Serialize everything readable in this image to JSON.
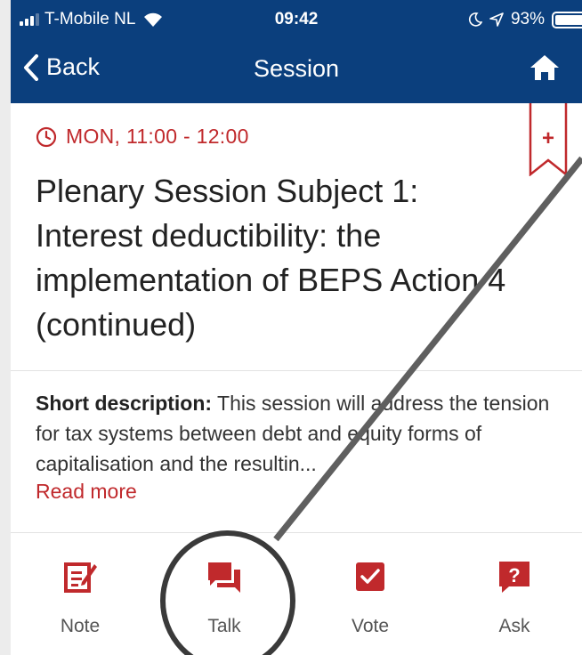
{
  "status_bar": {
    "carrier": "T-Mobile NL",
    "time": "09:42",
    "battery": "93%",
    "battery_level": 0.93
  },
  "nav": {
    "back_label": "Back",
    "title": "Session"
  },
  "session": {
    "time": "MON, 11:00 - 12:00",
    "title": "Plenary Session Subject 1: Interest deductibility: the implementation of BEPS Action 4 (continued)",
    "description_label": "Short description:",
    "description_text": " This session will address the tension for tax systems between debt and equity forms of capitalisation and the resultin...",
    "read_more": "Read more",
    "bookmark_symbol": "+"
  },
  "actions": [
    {
      "label": "Note",
      "icon": "note-edit-icon"
    },
    {
      "label": "Talk",
      "icon": "chat-icon"
    },
    {
      "label": "Vote",
      "icon": "checkbox-icon"
    },
    {
      "label": "Ask",
      "icon": "question-icon"
    }
  ],
  "colors": {
    "nav_bar": "#0b3f7d",
    "accent": "#c0292c",
    "annotation": "#5f5f5f"
  }
}
